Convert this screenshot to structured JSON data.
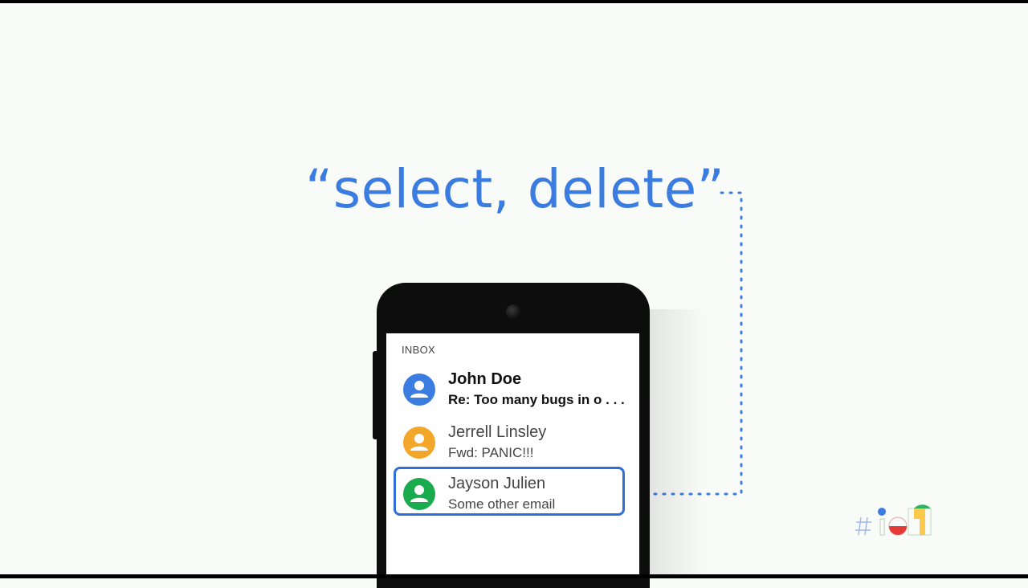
{
  "slide": {
    "quote": "“select, delete”"
  },
  "inbox": {
    "label": "INBOX",
    "emails": [
      {
        "sender": "John Doe",
        "subject": "Re: Too many bugs in o . . .",
        "avatar_color": "#3a7ce0",
        "unread": true
      },
      {
        "sender": "Jerrell Linsley",
        "subject": "Fwd: PANIC!!!",
        "avatar_color": "#f2a62a",
        "unread": false
      },
      {
        "sender": "Jayson Julien",
        "subject": "Some other email",
        "avatar_color": "#1aab4f",
        "unread": false,
        "selected": true
      }
    ]
  },
  "colors": {
    "accent_blue": "#3a7ce0",
    "selection_blue": "#2f6fd6",
    "background": "#f9fbf9"
  },
  "icons": {
    "avatar": "person-icon",
    "logo": "google-io-logo"
  }
}
